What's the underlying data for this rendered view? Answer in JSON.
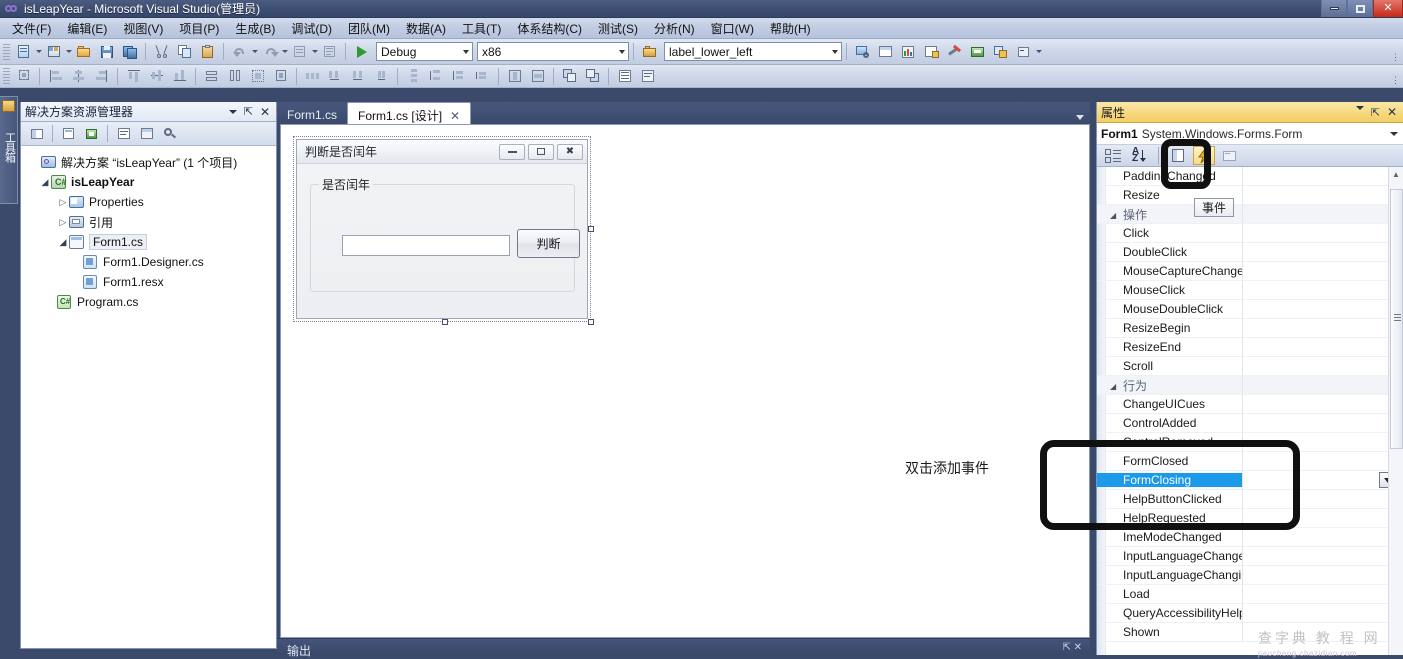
{
  "window": {
    "title": "isLeapYear - Microsoft Visual Studio(管理员)",
    "app_icon": "visual-studio-icon",
    "buttons": {
      "minimize": "minimize-icon",
      "maximize": "maximize-icon",
      "close": "close-icon"
    }
  },
  "menubar": {
    "items": [
      {
        "label": "文件(F)"
      },
      {
        "label": "编辑(E)"
      },
      {
        "label": "视图(V)"
      },
      {
        "label": "项目(P)"
      },
      {
        "label": "生成(B)"
      },
      {
        "label": "调试(D)"
      },
      {
        "label": "团队(M)"
      },
      {
        "label": "数据(A)"
      },
      {
        "label": "工具(T)"
      },
      {
        "label": "体系结构(C)"
      },
      {
        "label": "测试(S)"
      },
      {
        "label": "分析(N)"
      },
      {
        "label": "窗口(W)"
      },
      {
        "label": "帮助(H)"
      }
    ]
  },
  "toolbar": {
    "configuration": "Debug",
    "platform": "x86",
    "find_combo": "label_lower_left",
    "run_label": "start-debugging-icon"
  },
  "vertical_dock": {
    "label": "工具箱"
  },
  "solution_explorer": {
    "title": "解决方案资源管理器",
    "tree": [
      {
        "label": "解决方案 “isLeapYear” (1 个项目)",
        "icon": "solution-icon",
        "indent": 0,
        "arrow": "",
        "bold": false,
        "selected": false
      },
      {
        "label": "isLeapYear",
        "icon": "csharp-project-icon",
        "indent": 1,
        "arrow": "open",
        "bold": true,
        "selected": false
      },
      {
        "label": "Properties",
        "icon": "properties-folder-icon",
        "indent": 2,
        "arrow": "closed",
        "bold": false,
        "selected": false
      },
      {
        "label": "引用",
        "icon": "references-folder-icon",
        "indent": 2,
        "arrow": "closed",
        "bold": false,
        "selected": false
      },
      {
        "label": "Form1.cs",
        "icon": "form-file-icon",
        "indent": 2,
        "arrow": "open",
        "bold": false,
        "selected": true
      },
      {
        "label": "Form1.Designer.cs",
        "icon": "csharp-file-icon",
        "indent": 3,
        "arrow": "",
        "bold": false,
        "selected": false
      },
      {
        "label": "Form1.resx",
        "icon": "resx-file-icon",
        "indent": 3,
        "arrow": "",
        "bold": false,
        "selected": false
      },
      {
        "label": "Program.cs",
        "icon": "csharp-file-icon",
        "indent": 2,
        "arrow": "",
        "bold": false,
        "selected": false
      }
    ]
  },
  "document_tabs": [
    {
      "label": "Form1.cs",
      "active": false,
      "closable": false
    },
    {
      "label": "Form1.cs [设计]",
      "active": true,
      "closable": true
    }
  ],
  "designer": {
    "form_title": "判断是否闰年",
    "groupbox_label": "是否闰年",
    "textbox_value": "",
    "button_label": "判断",
    "annotation": "双击添加事件"
  },
  "output_panel": {
    "tab_label": "输出"
  },
  "properties": {
    "title": "属性",
    "object_name": "Form1",
    "object_type": "System.Windows.Forms.Form",
    "toolbar": {
      "categorized": "categorized-view-icon",
      "alphabetical": "alphabetical-sort-icon",
      "properties": "properties-view-icon",
      "events": "events-lightning-icon",
      "pages": "property-pages-icon"
    },
    "tooltip": "事件",
    "rows": [
      {
        "name": "PaddingChanged",
        "value": "",
        "kind": "prop",
        "selected": false
      },
      {
        "name": "Resize",
        "value": "",
        "kind": "prop",
        "selected": false
      },
      {
        "name": "操作",
        "value": "",
        "kind": "category",
        "selected": false
      },
      {
        "name": "Click",
        "value": "",
        "kind": "prop",
        "selected": false
      },
      {
        "name": "DoubleClick",
        "value": "",
        "kind": "prop",
        "selected": false
      },
      {
        "name": "MouseCaptureChanged",
        "value": "",
        "kind": "prop",
        "selected": false
      },
      {
        "name": "MouseClick",
        "value": "",
        "kind": "prop",
        "selected": false
      },
      {
        "name": "MouseDoubleClick",
        "value": "",
        "kind": "prop",
        "selected": false
      },
      {
        "name": "ResizeBegin",
        "value": "",
        "kind": "prop",
        "selected": false
      },
      {
        "name": "ResizeEnd",
        "value": "",
        "kind": "prop",
        "selected": false
      },
      {
        "name": "Scroll",
        "value": "",
        "kind": "prop",
        "selected": false
      },
      {
        "name": "行为",
        "value": "",
        "kind": "category",
        "selected": false
      },
      {
        "name": "ChangeUICues",
        "value": "",
        "kind": "prop",
        "selected": false
      },
      {
        "name": "ControlAdded",
        "value": "",
        "kind": "prop",
        "selected": false
      },
      {
        "name": "ControlRemoved",
        "value": "",
        "kind": "prop",
        "selected": false
      },
      {
        "name": "FormClosed",
        "value": "",
        "kind": "prop",
        "selected": false
      },
      {
        "name": "FormClosing",
        "value": "",
        "kind": "prop",
        "selected": true
      },
      {
        "name": "HelpButtonClicked",
        "value": "",
        "kind": "prop",
        "selected": false
      },
      {
        "name": "HelpRequested",
        "value": "",
        "kind": "prop",
        "selected": false
      },
      {
        "name": "ImeModeChanged",
        "value": "",
        "kind": "prop",
        "selected": false
      },
      {
        "name": "InputLanguageChanged",
        "value": "",
        "kind": "prop",
        "selected": false
      },
      {
        "name": "InputLanguageChanging",
        "value": "",
        "kind": "prop",
        "selected": false
      },
      {
        "name": "Load",
        "value": "",
        "kind": "prop",
        "selected": false
      },
      {
        "name": "QueryAccessibilityHelp",
        "value": "",
        "kind": "prop",
        "selected": false
      },
      {
        "name": "Shown",
        "value": "",
        "kind": "prop",
        "selected": false
      }
    ]
  },
  "watermark": {
    "line1": "查字典 教 程 网",
    "line2": "jiaocheng.chazidian.com"
  },
  "colors": {
    "chrome": "#3b4a6b",
    "properties_header": "#f2cd63",
    "selection": "#1a9ae8",
    "highlight_annotation": "#101010",
    "close_button": "#c32b16"
  }
}
